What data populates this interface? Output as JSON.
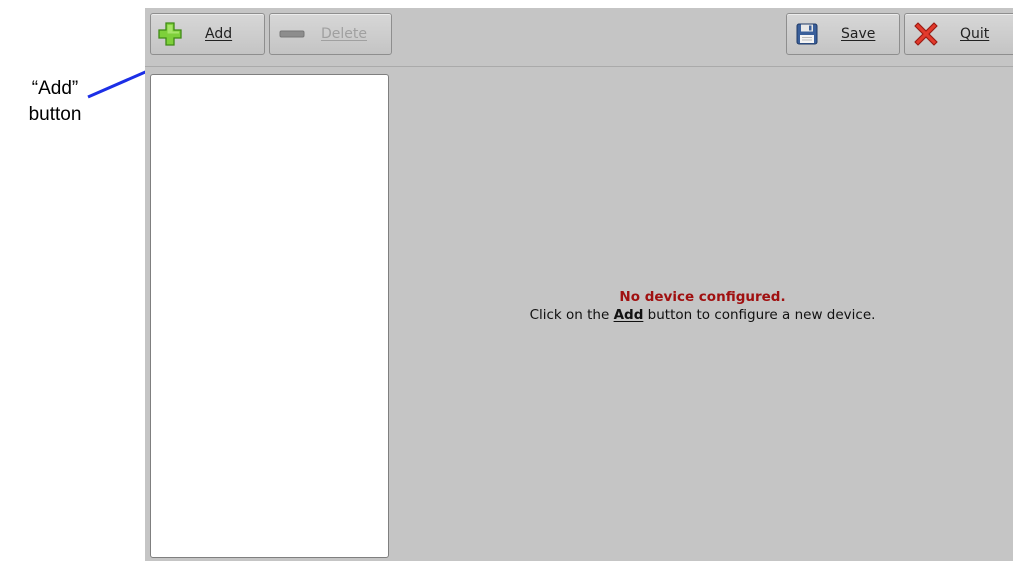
{
  "annotation": {
    "line1": "“Add”",
    "line2": "button",
    "arrow_color": "#1c2fe6"
  },
  "toolbar": {
    "add_label": "Add",
    "delete_label": "Delete",
    "save_label": "Save",
    "quit_label": "Quit",
    "icons": {
      "add": "plus-icon",
      "delete": "minus-icon",
      "save": "floppy-disk-icon",
      "quit": "red-x-icon"
    }
  },
  "device_list": {
    "items": []
  },
  "message": {
    "title": "No device configured.",
    "body_prefix": "Click on the ",
    "body_keyword": "Add",
    "body_suffix": " button to configure a new device."
  },
  "colors": {
    "window_bg": "#c5c5c5",
    "title_text": "#a01010",
    "list_bg": "#ffffff"
  }
}
